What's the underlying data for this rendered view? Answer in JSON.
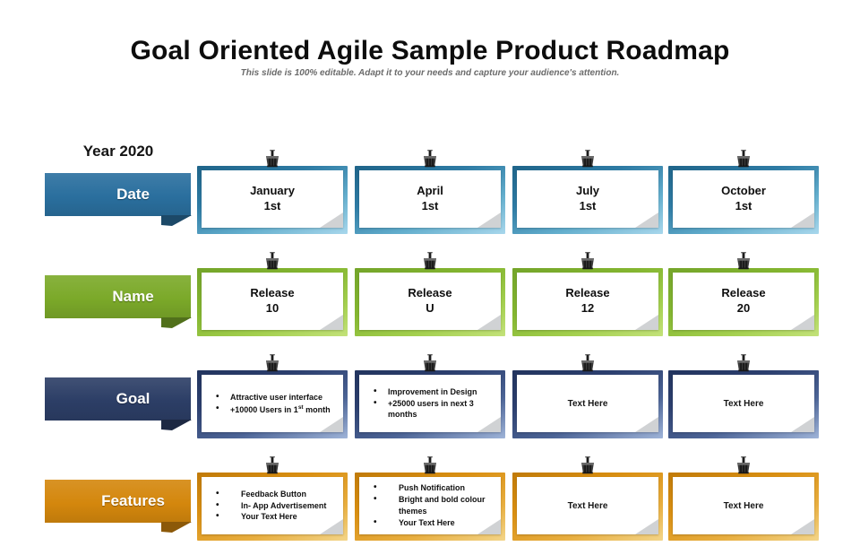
{
  "header": {
    "title": "Goal Oriented Agile Sample Product Roadmap",
    "subtitle": "This slide is  100% editable. Adapt it to your needs and capture your audience's attention."
  },
  "year_label": "Year 2020",
  "colors": {
    "date": "#2a6f9e",
    "name": "#7ba929",
    "goal": "#2c3e66",
    "features": "#d4870d"
  },
  "rows": [
    {
      "label": "Date",
      "color": "#2a6f9e",
      "cards": [
        {
          "line1": "January",
          "line2": "1st"
        },
        {
          "line1": "April",
          "line2": "1st"
        },
        {
          "line1": "July",
          "line2": "1st"
        },
        {
          "line1": "October",
          "line2": "1st"
        }
      ]
    },
    {
      "label": "Name",
      "color": "#7ba929",
      "cards": [
        {
          "line1": "Release",
          "line2": "10"
        },
        {
          "line1": "Release",
          "line2": "U"
        },
        {
          "line1": "Release",
          "line2": "12"
        },
        {
          "line1": "Release",
          "line2": "20"
        }
      ]
    },
    {
      "label": "Goal",
      "color": "#2c3e66",
      "cards": [
        {
          "bullets": [
            "Attractive user interface",
            "+10000 Users in 1st month"
          ]
        },
        {
          "bullets": [
            "Improvement in Design",
            "+25000 users in next 3 months"
          ]
        },
        {
          "text": "Text Here"
        },
        {
          "text": "Text Here"
        }
      ]
    },
    {
      "label": "Features",
      "color": "#d4870d",
      "cards": [
        {
          "bullets": [
            "Feedback Button",
            "In- App Advertisement",
            "Your Text Here"
          ]
        },
        {
          "bullets": [
            "Push Notification",
            "Bright and bold colour themes",
            "Your Text Here"
          ]
        },
        {
          "text": "Text Here"
        },
        {
          "text": "Text Here"
        }
      ]
    }
  ],
  "icons": {
    "clip": "binder-clip-icon"
  }
}
